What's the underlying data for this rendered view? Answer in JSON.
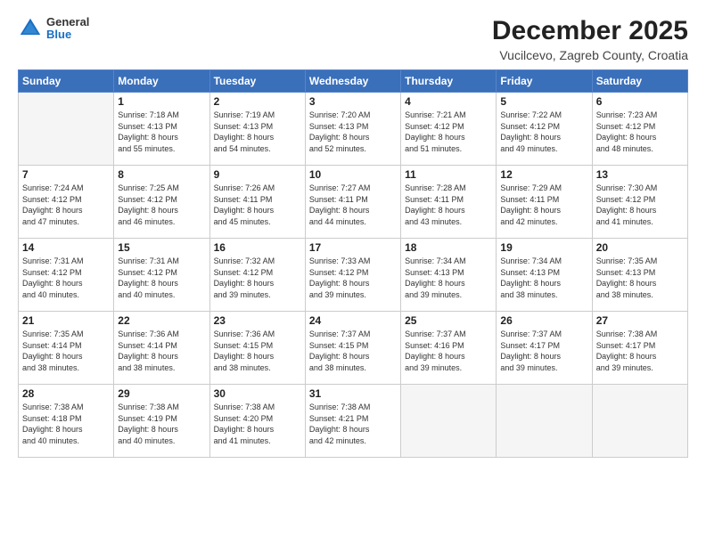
{
  "header": {
    "logo_general": "General",
    "logo_blue": "Blue",
    "month_title": "December 2025",
    "location": "Vucilcevo, Zagreb County, Croatia"
  },
  "days_of_week": [
    "Sunday",
    "Monday",
    "Tuesday",
    "Wednesday",
    "Thursday",
    "Friday",
    "Saturday"
  ],
  "weeks": [
    [
      {
        "day": "",
        "info": ""
      },
      {
        "day": "1",
        "info": "Sunrise: 7:18 AM\nSunset: 4:13 PM\nDaylight: 8 hours\nand 55 minutes."
      },
      {
        "day": "2",
        "info": "Sunrise: 7:19 AM\nSunset: 4:13 PM\nDaylight: 8 hours\nand 54 minutes."
      },
      {
        "day": "3",
        "info": "Sunrise: 7:20 AM\nSunset: 4:13 PM\nDaylight: 8 hours\nand 52 minutes."
      },
      {
        "day": "4",
        "info": "Sunrise: 7:21 AM\nSunset: 4:12 PM\nDaylight: 8 hours\nand 51 minutes."
      },
      {
        "day": "5",
        "info": "Sunrise: 7:22 AM\nSunset: 4:12 PM\nDaylight: 8 hours\nand 49 minutes."
      },
      {
        "day": "6",
        "info": "Sunrise: 7:23 AM\nSunset: 4:12 PM\nDaylight: 8 hours\nand 48 minutes."
      }
    ],
    [
      {
        "day": "7",
        "info": "Sunrise: 7:24 AM\nSunset: 4:12 PM\nDaylight: 8 hours\nand 47 minutes."
      },
      {
        "day": "8",
        "info": "Sunrise: 7:25 AM\nSunset: 4:12 PM\nDaylight: 8 hours\nand 46 minutes."
      },
      {
        "day": "9",
        "info": "Sunrise: 7:26 AM\nSunset: 4:11 PM\nDaylight: 8 hours\nand 45 minutes."
      },
      {
        "day": "10",
        "info": "Sunrise: 7:27 AM\nSunset: 4:11 PM\nDaylight: 8 hours\nand 44 minutes."
      },
      {
        "day": "11",
        "info": "Sunrise: 7:28 AM\nSunset: 4:11 PM\nDaylight: 8 hours\nand 43 minutes."
      },
      {
        "day": "12",
        "info": "Sunrise: 7:29 AM\nSunset: 4:11 PM\nDaylight: 8 hours\nand 42 minutes."
      },
      {
        "day": "13",
        "info": "Sunrise: 7:30 AM\nSunset: 4:12 PM\nDaylight: 8 hours\nand 41 minutes."
      }
    ],
    [
      {
        "day": "14",
        "info": "Sunrise: 7:31 AM\nSunset: 4:12 PM\nDaylight: 8 hours\nand 40 minutes."
      },
      {
        "day": "15",
        "info": "Sunrise: 7:31 AM\nSunset: 4:12 PM\nDaylight: 8 hours\nand 40 minutes."
      },
      {
        "day": "16",
        "info": "Sunrise: 7:32 AM\nSunset: 4:12 PM\nDaylight: 8 hours\nand 39 minutes."
      },
      {
        "day": "17",
        "info": "Sunrise: 7:33 AM\nSunset: 4:12 PM\nDaylight: 8 hours\nand 39 minutes."
      },
      {
        "day": "18",
        "info": "Sunrise: 7:34 AM\nSunset: 4:13 PM\nDaylight: 8 hours\nand 39 minutes."
      },
      {
        "day": "19",
        "info": "Sunrise: 7:34 AM\nSunset: 4:13 PM\nDaylight: 8 hours\nand 38 minutes."
      },
      {
        "day": "20",
        "info": "Sunrise: 7:35 AM\nSunset: 4:13 PM\nDaylight: 8 hours\nand 38 minutes."
      }
    ],
    [
      {
        "day": "21",
        "info": "Sunrise: 7:35 AM\nSunset: 4:14 PM\nDaylight: 8 hours\nand 38 minutes."
      },
      {
        "day": "22",
        "info": "Sunrise: 7:36 AM\nSunset: 4:14 PM\nDaylight: 8 hours\nand 38 minutes."
      },
      {
        "day": "23",
        "info": "Sunrise: 7:36 AM\nSunset: 4:15 PM\nDaylight: 8 hours\nand 38 minutes."
      },
      {
        "day": "24",
        "info": "Sunrise: 7:37 AM\nSunset: 4:15 PM\nDaylight: 8 hours\nand 38 minutes."
      },
      {
        "day": "25",
        "info": "Sunrise: 7:37 AM\nSunset: 4:16 PM\nDaylight: 8 hours\nand 39 minutes."
      },
      {
        "day": "26",
        "info": "Sunrise: 7:37 AM\nSunset: 4:17 PM\nDaylight: 8 hours\nand 39 minutes."
      },
      {
        "day": "27",
        "info": "Sunrise: 7:38 AM\nSunset: 4:17 PM\nDaylight: 8 hours\nand 39 minutes."
      }
    ],
    [
      {
        "day": "28",
        "info": "Sunrise: 7:38 AM\nSunset: 4:18 PM\nDaylight: 8 hours\nand 40 minutes."
      },
      {
        "day": "29",
        "info": "Sunrise: 7:38 AM\nSunset: 4:19 PM\nDaylight: 8 hours\nand 40 minutes."
      },
      {
        "day": "30",
        "info": "Sunrise: 7:38 AM\nSunset: 4:20 PM\nDaylight: 8 hours\nand 41 minutes."
      },
      {
        "day": "31",
        "info": "Sunrise: 7:38 AM\nSunset: 4:21 PM\nDaylight: 8 hours\nand 42 minutes."
      },
      {
        "day": "",
        "info": ""
      },
      {
        "day": "",
        "info": ""
      },
      {
        "day": "",
        "info": ""
      }
    ]
  ]
}
